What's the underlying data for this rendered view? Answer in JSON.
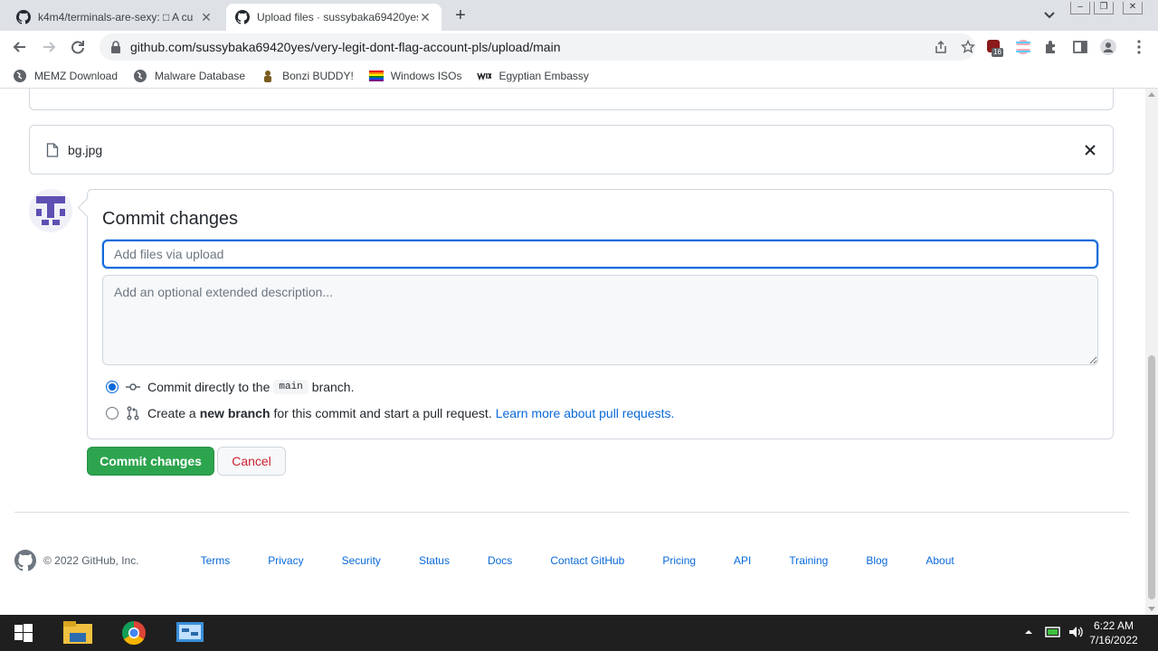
{
  "browser": {
    "tabs": [
      {
        "title": "k4m4/terminals-are-sexy: □ A cu",
        "active": false
      },
      {
        "title": "Upload files · sussybaka69420yes/",
        "active": true
      }
    ],
    "new_tab": "+",
    "url": "github.com/sussybaka69420yes/very-legit-dont-flag-account-pls/upload/main",
    "extension_badge": "16",
    "bookmarks": [
      {
        "label": "MEMZ Download",
        "icon": "globe-icon"
      },
      {
        "label": "Malware Database",
        "icon": "globe-icon"
      },
      {
        "label": "Bonzi BUDDY!",
        "icon": "bonzi-icon"
      },
      {
        "label": "Windows ISOs",
        "icon": "rainbow-flag-icon"
      },
      {
        "label": "Egyptian Embassy",
        "icon": "wix-icon"
      }
    ]
  },
  "upload": {
    "file_name": "bg.jpg"
  },
  "commit": {
    "title": "Commit changes",
    "summary_placeholder": "Add files via upload",
    "description_placeholder": "Add an optional extended description...",
    "option_direct": {
      "prefix": "Commit directly to the",
      "branch": "main",
      "suffix": "branch."
    },
    "option_new_branch": {
      "prefix": "Create a",
      "emphasis": "new branch",
      "suffix": "for this commit and start a pull request.",
      "link": "Learn more about pull requests."
    },
    "submit_label": "Commit changes",
    "cancel_label": "Cancel"
  },
  "footer": {
    "copyright": "© 2022 GitHub, Inc.",
    "links": [
      "Terms",
      "Privacy",
      "Security",
      "Status",
      "Docs",
      "Contact GitHub",
      "Pricing",
      "API",
      "Training",
      "Blog",
      "About"
    ]
  },
  "taskbar": {
    "time": "6:22 AM",
    "date": "7/16/2022"
  },
  "colors": {
    "primary_green": "#2da44e",
    "link_blue": "#0969da",
    "danger_red": "#cf222e",
    "focus_blue": "#0969da"
  }
}
